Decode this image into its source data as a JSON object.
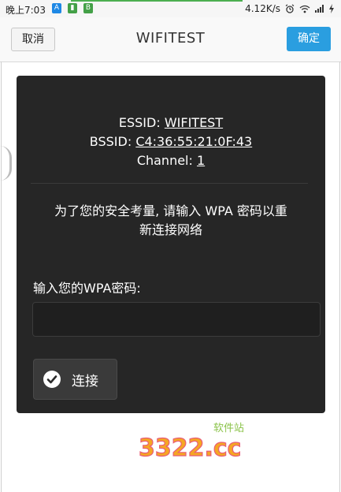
{
  "status_bar": {
    "time": "晚上7:03",
    "app_icons": [
      "A",
      "▮",
      "B"
    ],
    "net_speed": "4.12K/s",
    "icons": [
      "alarm-icon",
      "wifi-icon",
      "signal-icon",
      "charging-icon"
    ]
  },
  "title_bar": {
    "cancel_label": "取消",
    "title": "WIFITEST",
    "confirm_label": "确定"
  },
  "dialog": {
    "essid_label": "ESSID:",
    "essid_value": "WIFITEST",
    "bssid_label": "BSSID:",
    "bssid_value": "C4:36:55:21:0F:43",
    "channel_label": "Channel:",
    "channel_value": "1",
    "message_line1": "为了您的安全考量, 请输入 WPA 密码以重",
    "message_line2": "新连接网络",
    "password_label": "输入您的WPA密码:",
    "password_value": "",
    "connect_label": "连接"
  },
  "watermark": {
    "logo_text": "3322.cc",
    "tagline": "软件站"
  },
  "colors": {
    "accent": "#2a9ee0",
    "dialog_bg": "#262626",
    "progress": "#4caf50"
  }
}
